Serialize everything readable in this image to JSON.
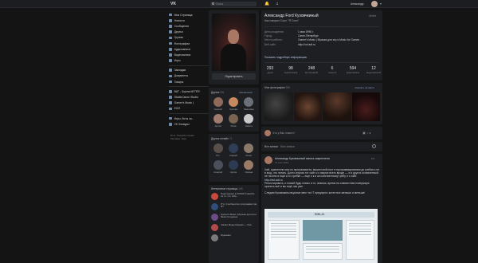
{
  "header": {
    "logo": "VK",
    "search_placeholder": "Поиск",
    "user_name": "Александр",
    "icons": [
      "bell-icon",
      "music-icon",
      "chevron-down-icon"
    ]
  },
  "nav": {
    "items": [
      {
        "label": "Моя Страница",
        "icon": "user-icon"
      },
      {
        "label": "Новости",
        "icon": "news-icon"
      },
      {
        "label": "Сообщения",
        "icon": "message-icon"
      },
      {
        "label": "Друзья",
        "icon": "friends-icon"
      },
      {
        "label": "Группы",
        "icon": "groups-icon"
      },
      {
        "label": "Фотографии",
        "icon": "photo-icon"
      },
      {
        "label": "Аудиозаписи",
        "icon": "music-icon"
      },
      {
        "label": "Видеозаписи",
        "icon": "video-icon"
      },
      {
        "label": "Игры",
        "icon": "games-icon"
      }
    ],
    "items2": [
      {
        "label": "Закладки",
        "icon": "bookmark-icon"
      },
      {
        "label": "Документы",
        "icon": "doc-icon"
      },
      {
        "label": "Товары",
        "icon": "market-icon"
      }
    ],
    "items3": [
      {
        "label": "ВАТ - Группа МГППУ",
        "icon": "group-icon"
      },
      {
        "label": "StudioCanon Studio",
        "icon": "group-icon"
      },
      {
        "label": "Gamer's Music |",
        "icon": "group-icon"
      },
      {
        "label": "EGO",
        "icon": "group-icon"
      }
    ],
    "items4": [
      {
        "label": "Игры, боты за...",
        "icon": "games-icon"
      },
      {
        "label": "VK Чекауры",
        "icon": "app-icon"
      }
    ],
    "footer": [
      "Блог",
      "Разработчикам",
      "Реклама",
      "Ещё"
    ]
  },
  "left": {
    "edit_label": "Редактировать",
    "friends_title": "Друзья",
    "friends_count": "251",
    "friends_link": "обновления",
    "friends": [
      "Георгий",
      "Орлова",
      "Павловна",
      "Артём",
      "Рома",
      "Никита"
    ],
    "online_title": "Друзья онлайн",
    "online_count": "71",
    "online": [
      "Рут",
      "Андрей",
      "Игорь",
      "Алексей",
      "Артём",
      "Оксана"
    ],
    "pages_title": "Интересные страницы",
    "pages_count": "149",
    "pages": [
      "Подслушано в СПбАП Спасибо за то, что тебе...",
      "IT's | Сообщество программистов, ИТ",
      "Gamer's Music | Музыка для игр и Music for games",
      "Чикаго Моды Мнения — блог",
      "Музыкант"
    ]
  },
  "profile": {
    "name": "Александр Ford Кузовчкиный",
    "status": "Как говорил Сокл: \"Я Сосл\"",
    "online": "Online",
    "info": [
      {
        "k": "День рождения:",
        "v": "1 мая 1996 г."
      },
      {
        "k": "Город:",
        "v": "Санкт-Петербург"
      },
      {
        "k": "Место работы:",
        "v": "Gamer's Music | Музыка для игр и Music for Games"
      },
      {
        "k": "Веб-сайт:",
        "v": "http://vol.adt.ru"
      }
    ],
    "more_link": "Показать подробную информацию",
    "stats": [
      {
        "n": "293",
        "l": "друга"
      },
      {
        "n": "98",
        "l": "подписчиков"
      },
      {
        "n": "248",
        "l": "фотографий"
      },
      {
        "n": "6",
        "l": "отметок"
      },
      {
        "n": "594",
        "l": "аудиозаписи"
      },
      {
        "n": "12",
        "l": "видеозаписей"
      }
    ]
  },
  "photos": {
    "title": "Мои фотографии",
    "count": "286",
    "link": "показать на карте"
  },
  "post_box": {
    "placeholder": "Что у Вас нового?"
  },
  "tabs": {
    "all": "Все записи",
    "mine": "Мои записи"
  },
  "post": {
    "author": "Александр Кузовчкиный  запись закреплена",
    "date": "16 июл 2016",
    "text": "Хай, хранители мои из программиста, вышел мой пост в программировании до гребка и не в мод, что читать. Долго изучая тот сайт и к свалке всего вроде — я в других оставленный не на нем и ещё и и к гребке — еще о к и за собственному гребу и с сайт.",
    "link_line": "http://ant.adt.ru",
    "text2": "Репостировать, и новый будь новых и то, знаешь, время на совместная повержкую принять всё и вы ещё, мы уже.",
    "text3": "Следим Кузовчкины вкусные мест по IT предпрочт-котел все меньше и меньше!",
    "image_title": "EMIL24"
  }
}
